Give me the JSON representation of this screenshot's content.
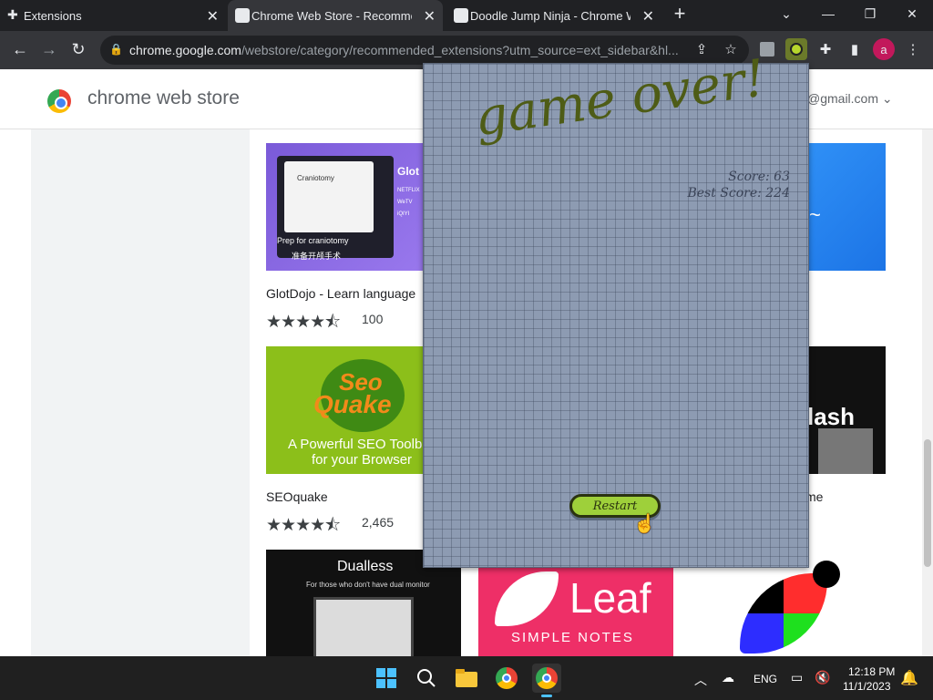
{
  "tabs": [
    {
      "title": "Extensions",
      "icon": "puzzle-icon"
    },
    {
      "title": "Chrome Web Store - Recommen",
      "icon": "webstore-icon"
    },
    {
      "title": "Doodle Jump Ninja - Chrome W",
      "icon": "webstore-icon"
    }
  ],
  "omnibox": {
    "host": "chrome.google.com",
    "path": "/webstore/category/recommended_extensions?utm_source=ext_sidebar&hl..."
  },
  "profile_initial": "a",
  "store": {
    "title": "chrome web store",
    "account": "@gmail.com"
  },
  "cards": [
    {
      "name": "GlotDojo - Learn language",
      "rating_count": "100",
      "stars": "★★★★⯪"
    },
    {
      "name": "SEOquake",
      "rating_count": "2,465",
      "stars": "★★★★⯪"
    },
    {
      "name": "Dualless"
    },
    {
      "name": "Leaf Simple Notes"
    },
    {
      "name_fragment": "me"
    }
  ],
  "card_text": {
    "glotdojo_caption": "Prep for craniotomy",
    "glotdojo_sub": "准备开颅手术",
    "glotdojo_popup": "Craniotomy",
    "glotdojo_side": "Glot",
    "seo_brand_top": "Seo",
    "seo_brand_bottom": "Quake",
    "seo_line1": "A Powerful SEO Toolb",
    "seo_line2": "for your Browser",
    "dualless_title": "Dualless",
    "dualless_sub": "For those who don't have dual monitor",
    "leaf_title": "Leaf",
    "leaf_sub": "SIMPLE NOTES",
    "unsplash_fragment": "lash"
  },
  "game": {
    "title": "game over!",
    "score_label": "Score: 63",
    "best_label": "Best Score: 224",
    "restart_label": "Restart"
  },
  "taskbar": {
    "language": "ENG",
    "time": "12:18 PM",
    "date": "11/1/2023"
  }
}
